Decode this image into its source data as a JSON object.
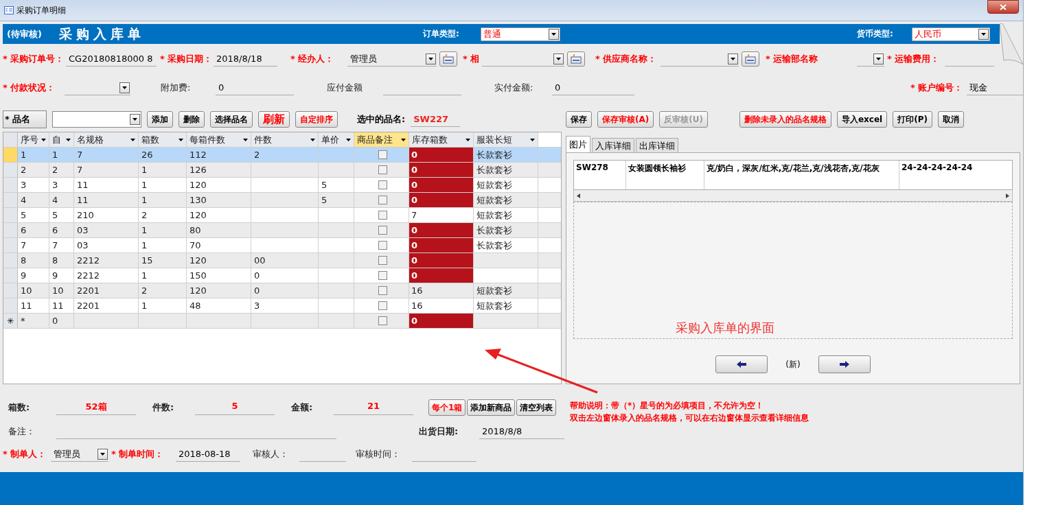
{
  "window": {
    "title": "采购订单明细"
  },
  "header": {
    "status": "(待审核)",
    "title": "采购入库单",
    "order_type": {
      "label": "订单类型:",
      "value": "普通"
    },
    "currency": {
      "label": "货币类型:",
      "value": "人民币"
    }
  },
  "fields_row1": [
    {
      "label": "* 采购订单号：",
      "value": "CG20180818000 8",
      "required": true,
      "kind": "text"
    },
    {
      "label": "* 采购日期：",
      "value": "2018/8/18",
      "required": true,
      "kind": "text"
    },
    {
      "label": "* 经办人：",
      "value": "管理员",
      "required": true,
      "kind": "combo",
      "add_button": true
    },
    {
      "label": "* 相",
      "required": true,
      "kind": "combo",
      "add_button": true
    },
    {
      "label": "* 供应商名称：",
      "required": true,
      "kind": "combo",
      "add_button": true
    },
    {
      "label": "* 运输部名称",
      "required": true,
      "kind": "combo"
    },
    {
      "label": "* 运输费用：",
      "required": true,
      "kind": "text"
    }
  ],
  "fields_row2": [
    {
      "label": "* 付款状况：",
      "required": true,
      "kind": "combo"
    },
    {
      "label": "附加费:",
      "value": "0",
      "required": false,
      "kind": "text"
    },
    {
      "label": "应付金额",
      "required": false,
      "kind": "text"
    },
    {
      "label": "实付金额:",
      "value": "0",
      "required": false,
      "kind": "text"
    },
    {
      "label": "* 账户编号：",
      "value": "现金",
      "required": true,
      "kind": "combo"
    }
  ],
  "item_bar": {
    "label": "* 品名",
    "buttons": [
      {
        "label": "添加",
        "kind": "plain"
      },
      {
        "label": "删除",
        "kind": "plain"
      },
      {
        "label": "选择品名",
        "kind": "plain"
      },
      {
        "label": "刷新",
        "kind": "large"
      },
      {
        "label": "自定排序",
        "kind": "warning"
      }
    ],
    "selected_label": "选中的品名:",
    "selected_value": "SW227"
  },
  "grid": {
    "columns": [
      "序号",
      "自",
      "名规格",
      "箱数",
      "每箱件数",
      "件数",
      "单价",
      "商品备注",
      "库存箱数",
      "服装长短"
    ],
    "rows": [
      {
        "no": "1",
        "seq": "1",
        "spec": "7",
        "boxes": "26",
        "per_box": "112",
        "qty": "2",
        "note_checked": false,
        "stock": "0",
        "stock_alert": true,
        "length": "长款套衫",
        "selected": true
      },
      {
        "no": "2",
        "seq": "2",
        "spec": "7",
        "boxes": "1",
        "per_box": "126",
        "note_checked": false,
        "stock": "0",
        "stock_alert": true,
        "length": "长款套衫",
        "selected": false
      },
      {
        "no": "3",
        "seq": "3",
        "spec": "11",
        "boxes": "1",
        "per_box": "120",
        "price": "5",
        "note_checked": false,
        "stock": "0",
        "stock_alert": true,
        "length": "短款套衫",
        "selected": false
      },
      {
        "no": "4",
        "seq": "4",
        "spec": "11",
        "boxes": "1",
        "per_box": "130",
        "price": "5",
        "note_checked": false,
        "stock": "0",
        "stock_alert": true,
        "length": "短款套衫",
        "selected": false
      },
      {
        "no": "5",
        "seq": "5",
        "spec": "210",
        "boxes": "2",
        "per_box": "120",
        "note_checked": false,
        "stock": "7",
        "stock_alert": false,
        "length": "短款套衫",
        "selected": false
      },
      {
        "no": "6",
        "seq": "6",
        "spec": "03",
        "boxes": "1",
        "per_box": "80",
        "note_checked": false,
        "stock": "0",
        "stock_alert": true,
        "length": "长款套衫",
        "selected": false
      },
      {
        "no": "7",
        "seq": "7",
        "spec": "03",
        "boxes": "1",
        "per_box": "70",
        "note_checked": false,
        "stock": "0",
        "stock_alert": true,
        "length": "长款套衫",
        "selected": false
      },
      {
        "no": "8",
        "seq": "8",
        "spec": "2212",
        "boxes": "15",
        "per_box": "120",
        "qty": "00",
        "note_checked": false,
        "stock": "0",
        "stock_alert": true,
        "selected": false
      },
      {
        "no": "9",
        "seq": "9",
        "spec": "2212",
        "boxes": "1",
        "per_box": "150",
        "qty": "0",
        "note_checked": false,
        "stock": "0",
        "stock_alert": true,
        "selected": false
      },
      {
        "no": "10",
        "seq": "10",
        "spec": "2201",
        "boxes": "2",
        "per_box": "120",
        "qty": "0",
        "note_checked": false,
        "stock": "16",
        "stock_alert": false,
        "length": "短款套衫",
        "selected": false
      },
      {
        "no": "11",
        "seq": "11",
        "spec": "2201",
        "boxes": "1",
        "per_box": "48",
        "qty": "3",
        "note_checked": false,
        "stock": "16",
        "stock_alert": false,
        "length": "短款套衫",
        "selected": false
      }
    ],
    "new_row": {
      "marker": "✳",
      "no": "*",
      "seq": "0",
      "note_checked": false,
      "stock": "0",
      "stock_alert": true
    }
  },
  "actions": [
    {
      "label": "保存",
      "kind": "plain",
      "disabled": false
    },
    {
      "label": "保存审核(A)",
      "kind": "warning",
      "disabled": false
    },
    {
      "label": "反审核(U)",
      "kind": "plain",
      "disabled": true
    },
    {
      "label": "删除未录入的品名规格",
      "kind": "warning",
      "disabled": false
    },
    {
      "label": "导入excel",
      "kind": "plain",
      "disabled": false
    },
    {
      "label": "打印(P)",
      "kind": "plain",
      "disabled": false
    },
    {
      "label": "取消",
      "kind": "plain",
      "disabled": false
    }
  ],
  "tabs": [
    {
      "label": "图片",
      "selected": true
    },
    {
      "label": "入库详细",
      "selected": false
    },
    {
      "label": "出库详细",
      "selected": false
    }
  ],
  "detail_row": [
    "SW278",
    "女装圆领长袖衫",
    "克/奶白，深灰/红米,克/花兰,克/浅花杏,克/花灰",
    "24-24-24-24-24"
  ],
  "record_nav": {
    "label": "(新)"
  },
  "annotation": "采购入库单的界面",
  "totals": [
    {
      "label": "箱数:",
      "value": "52箱"
    },
    {
      "label": "件数:",
      "value": "5"
    },
    {
      "label": "金额:",
      "value": "21"
    }
  ],
  "bottom_buttons": [
    {
      "label": "每个1箱",
      "kind": "warning"
    },
    {
      "label": "添加新商品",
      "kind": "plain"
    },
    {
      "label": "清空列表",
      "kind": "plain"
    }
  ],
  "help": [
    "帮助说明：带（*）星号的为必填项目，不允许为空！",
    "双击左边窗体录入的品名规格，可以在右边窗体显示查看详细信息"
  ],
  "remark": {
    "label": "备注："
  },
  "ship_date": {
    "label": "出货日期:",
    "value": "2018/8/8"
  },
  "footer_fields": [
    {
      "label": "* 制单人：",
      "value": "管理员",
      "required": true,
      "kind": "combo"
    },
    {
      "label": "* 制单时间：",
      "value": "2018-08-18",
      "required": true,
      "kind": "text"
    },
    {
      "label": "审核人：",
      "required": false,
      "kind": "text"
    },
    {
      "label": "审核时间：",
      "required": false,
      "kind": "text"
    }
  ]
}
